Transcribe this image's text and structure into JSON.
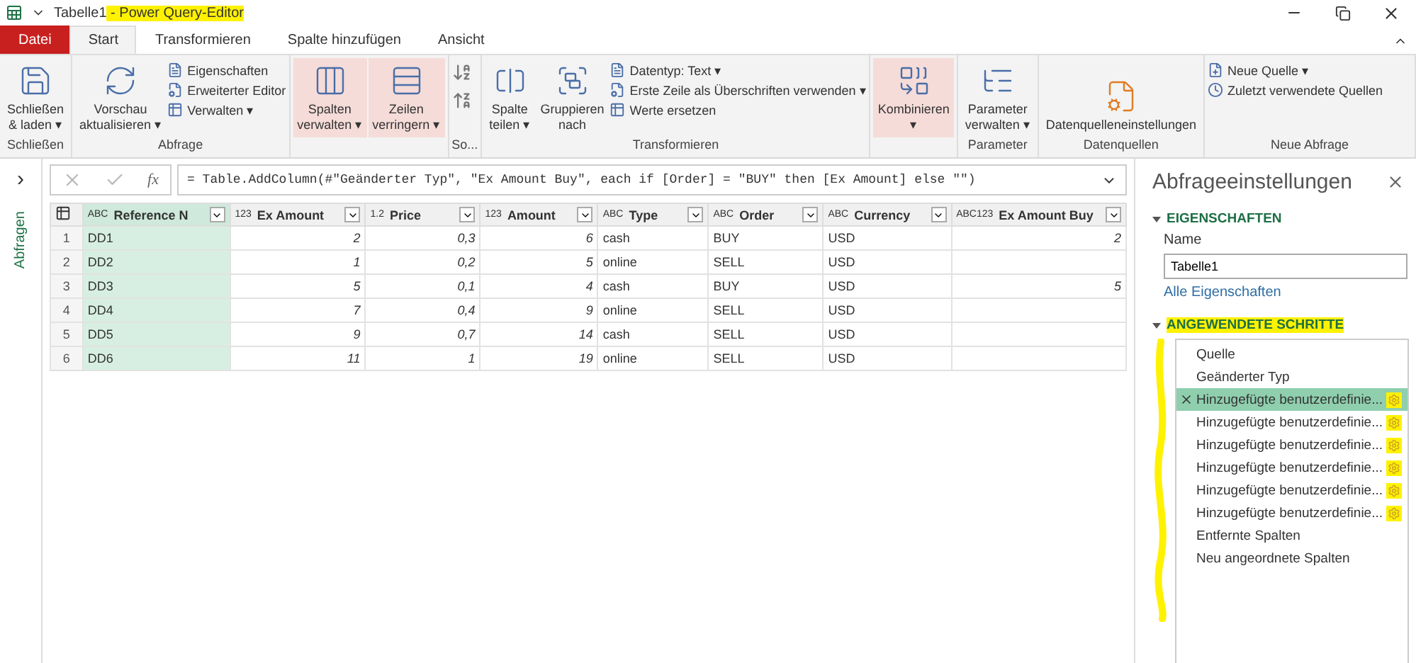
{
  "window": {
    "title_parts": [
      {
        "text": "Tabelle1",
        "highlight": false
      },
      {
        "text": " - Power Query-Editor",
        "highlight": true
      }
    ]
  },
  "tabs": [
    {
      "label": "Datei",
      "kind": "file",
      "selected": false
    },
    {
      "label": "Start",
      "kind": "tab",
      "selected": true
    },
    {
      "label": "Transformieren",
      "kind": "tab",
      "selected": false
    },
    {
      "label": "Spalte hinzufügen",
      "kind": "tab",
      "selected": false
    },
    {
      "label": "Ansicht",
      "kind": "tab",
      "selected": false
    }
  ],
  "ribbon": [
    {
      "label": "Schließen",
      "items": [
        {
          "kind": "big",
          "lines": [
            "Schließen",
            "& laden ▾"
          ],
          "pressed": false
        }
      ]
    },
    {
      "label": "Abfrage",
      "items": [
        {
          "kind": "big",
          "lines": [
            "Vorschau",
            "aktualisieren ▾"
          ],
          "pressed": false
        },
        {
          "kind": "stack",
          "entries": [
            "Eigenschaften",
            "Erweiterter Editor",
            "Verwalten ▾"
          ]
        }
      ]
    },
    {
      "items": [
        {
          "kind": "big",
          "lines": [
            "Spalten",
            "verwalten ▾"
          ],
          "pressed": true
        },
        {
          "kind": "big",
          "lines": [
            "Zeilen",
            "verringern ▾"
          ],
          "pressed": true
        }
      ]
    },
    {
      "label": "So...",
      "items": [
        {
          "kind": "sort"
        }
      ]
    },
    {
      "label": "Transformieren",
      "items": [
        {
          "kind": "big",
          "lines": [
            "Spalte",
            "teilen ▾"
          ],
          "pressed": false
        },
        {
          "kind": "big",
          "lines": [
            "Gruppieren",
            "nach"
          ],
          "pressed": false
        },
        {
          "kind": "stack",
          "entries": [
            "Datentyp: Text ▾",
            "Erste Zeile als Überschriften verwenden ▾",
            "Werte ersetzen"
          ]
        }
      ]
    },
    {
      "items": [
        {
          "kind": "big",
          "lines": [
            "Kombinieren",
            "▾"
          ],
          "pressed": true
        }
      ]
    },
    {
      "label": "Parameter",
      "items": [
        {
          "kind": "big",
          "lines": [
            "Parameter",
            "verwalten ▾"
          ],
          "pressed": false
        }
      ]
    },
    {
      "label": "Datenquellen",
      "items": [
        {
          "kind": "big",
          "lines": [
            "Datenquelleneinstellungen"
          ],
          "pressed": false
        }
      ]
    },
    {
      "label": "Neue Abfrage",
      "items": [
        {
          "kind": "stack",
          "entries": [
            "Neue Quelle ▾",
            "Zuletzt verwendete Quellen"
          ]
        }
      ]
    }
  ],
  "nav": {
    "label": "Abfragen",
    "chevron": "›"
  },
  "formula_label": "fx",
  "formula": "= Table.AddColumn(#\"Geänderter Typ\", \"Ex Amount Buy\", each if [Order] = \"BUY\" then [Ex Amount] else \"\")",
  "table": {
    "columns": [
      {
        "type": "ABC",
        "name": "Reference N",
        "selected": true
      },
      {
        "type": "123",
        "name": "Ex Amount",
        "selected": false
      },
      {
        "type": "1.2",
        "name": "Price",
        "selected": false
      },
      {
        "type": "123",
        "name": "Amount",
        "selected": false
      },
      {
        "type": "ABC",
        "name": "Type",
        "selected": false
      },
      {
        "type": "ABC",
        "name": "Order",
        "selected": false
      },
      {
        "type": "ABC",
        "name": "Currency",
        "selected": false
      },
      {
        "type": "ABC123",
        "name": "Ex Amount Buy",
        "selected": false
      }
    ],
    "rows": [
      {
        "number": "1",
        "cells": [
          "DD1",
          "2",
          "0,3",
          "6",
          "cash",
          "BUY",
          "USD",
          "2"
        ]
      },
      {
        "number": "2",
        "cells": [
          "DD2",
          "1",
          "0,2",
          "5",
          "online",
          "SELL",
          "USD",
          ""
        ]
      },
      {
        "number": "3",
        "cells": [
          "DD3",
          "5",
          "0,1",
          "4",
          "cash",
          "BUY",
          "USD",
          "5"
        ]
      },
      {
        "number": "4",
        "cells": [
          "DD4",
          "7",
          "0,4",
          "9",
          "online",
          "SELL",
          "USD",
          ""
        ]
      },
      {
        "number": "5",
        "cells": [
          "DD5",
          "9",
          "0,7",
          "14",
          "cash",
          "SELL",
          "USD",
          ""
        ]
      },
      {
        "number": "6",
        "cells": [
          "DD6",
          "11",
          "1",
          "19",
          "online",
          "SELL",
          "USD",
          ""
        ]
      }
    ]
  },
  "settings": {
    "title": "Abfrageeinstellungen",
    "properties_heading": "EIGENSCHAFTEN",
    "name_label": "Name",
    "name_value": "Tabelle1",
    "all_properties": "Alle Eigenschaften",
    "steps_heading": "ANGEWENDETE SCHRITTE",
    "steps_highlight": true,
    "steps": [
      {
        "label": "Quelle",
        "selected": false,
        "gear": false
      },
      {
        "label": "Geänderter Typ",
        "selected": false,
        "gear": false
      },
      {
        "label": "Hinzugefügte benutzerdefinie...",
        "selected": true,
        "gear": true
      },
      {
        "label": "Hinzugefügte benutzerdefinie...",
        "selected": false,
        "gear": true
      },
      {
        "label": "Hinzugefügte benutzerdefinie...",
        "selected": false,
        "gear": true
      },
      {
        "label": "Hinzugefügte benutzerdefinie...",
        "selected": false,
        "gear": true
      },
      {
        "label": "Hinzugefügte benutzerdefinie...",
        "selected": false,
        "gear": true
      },
      {
        "label": "Hinzugefügte benutzerdefinie...",
        "selected": false,
        "gear": true
      },
      {
        "label": "Entfernte Spalten",
        "selected": false,
        "gear": false
      },
      {
        "label": "Neu angeordnete Spalten",
        "selected": false,
        "gear": false
      }
    ]
  }
}
